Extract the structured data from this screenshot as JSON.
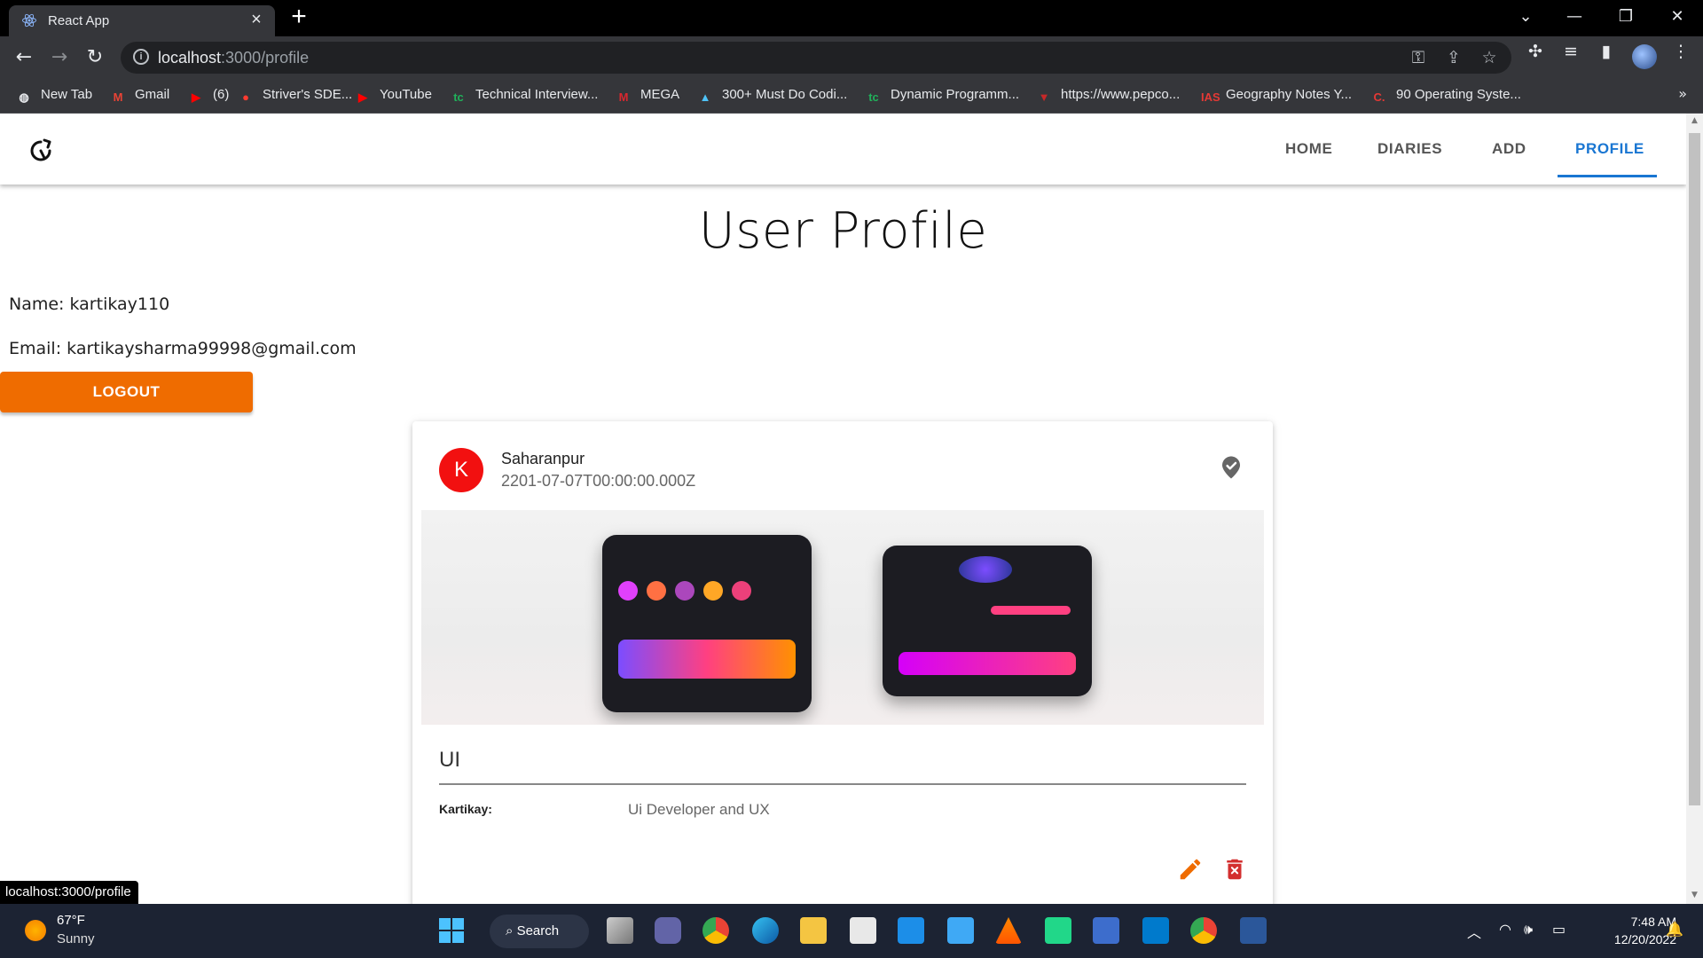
{
  "browser": {
    "tab_title": "React App",
    "url_host": "localhost",
    "url_path": ":3000/profile",
    "bookmarks": [
      {
        "label": "New Tab",
        "icon": "globe-icon",
        "color": "#e8eaed"
      },
      {
        "label": "Gmail",
        "icon": "gmail-icon",
        "color": "#ea4335"
      },
      {
        "label": "(6)",
        "icon": "youtube-icon",
        "color": "#ff0000"
      },
      {
        "label": "Striver's SDE...",
        "icon": "red-dot-icon",
        "color": "#ff3b30"
      },
      {
        "label": "YouTube",
        "icon": "youtube-icon",
        "color": "#ff0000"
      },
      {
        "label": "Technical Interview...",
        "icon": "tc-icon",
        "color": "#20b15a"
      },
      {
        "label": "MEGA",
        "icon": "mega-icon",
        "color": "#d9272e"
      },
      {
        "label": "300+ Must Do Codi...",
        "icon": "mountain-icon",
        "color": "#4fc3f7"
      },
      {
        "label": "Dynamic Programm...",
        "icon": "tc-icon",
        "color": "#20b15a"
      },
      {
        "label": "https://www.pepco...",
        "icon": "cap-icon",
        "color": "#c62828"
      },
      {
        "label": "Geography Notes Y...",
        "icon": "ias-icon",
        "color": "#e53935"
      },
      {
        "label": "90 Operating Syste...",
        "icon": "c-icon",
        "color": "#e53935"
      }
    ],
    "bookmarks_more": "»",
    "status_url": "localhost:3000/profile"
  },
  "nav": {
    "items": [
      "HOME",
      "DIARIES",
      "ADD",
      "PROFILE"
    ],
    "active": "PROFILE"
  },
  "profile": {
    "heading": "User Profile",
    "name_line": "Name: kartikay110",
    "email_line": "Email: kartikaysharma99998@gmail.com",
    "logout_label": "LOGOUT"
  },
  "card": {
    "avatar_letter": "K",
    "avatar_color": "#f21010",
    "location": "Saharanpur",
    "date": "2201-07-07T00:00:00.000Z",
    "title": "UI",
    "author_label": "Kartikay:",
    "description": "Ui Developer and UX"
  },
  "taskbar": {
    "weather_temp": "67°F",
    "weather_desc": "Sunny",
    "search_label": "Search",
    "time": "7:48 AM",
    "date": "12/20/2022"
  },
  "colors": {
    "accent": "#1976d2",
    "logout": "#ef6c00",
    "edit_icon": "#ef6c00",
    "delete_icon": "#d32f2f"
  }
}
